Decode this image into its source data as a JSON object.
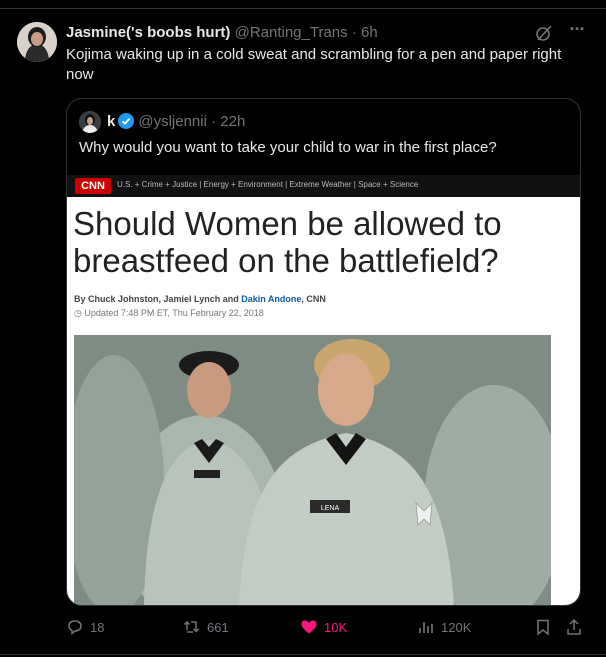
{
  "tweet": {
    "author_name": "Jasmine('s boobs hurt)",
    "author_handle": "@Ranting_Trans",
    "time": "· 6h",
    "text": "Kojima waking up in a cold sweat and scrambling for a pen and paper right now"
  },
  "quoted": {
    "author_name": "k",
    "author_handle": "@ysljennii",
    "time": "· 22h",
    "text": "Why would you want to take your child to war in the first place?",
    "article": {
      "logo": "CNN",
      "nav": "U.S. + Crime + Justice | Energy + Environment | Extreme Weather | Space + Science",
      "headline": "Should Women be allowed to breastfeed on the battlefield?",
      "byline_prefix": "By Chuck Johnston, Jamiel Lynch and ",
      "byline_link": "Dakin Andone",
      "byline_suffix": ", CNN",
      "updated": "Updated 7:48 PM ET, Thu February 22, 2018",
      "name_tag": "LENA"
    }
  },
  "actions": {
    "replies": "18",
    "reposts": "661",
    "likes": "10K",
    "views": "120K"
  },
  "colors": {
    "background": "#000000",
    "text": "#e7e9ea",
    "muted": "#71767b",
    "like": "#f91880",
    "verified": "#1d9bf0",
    "cnn_red": "#cc0000"
  },
  "icons": [
    "grok-icon",
    "more-icon",
    "verified-icon",
    "reply-icon",
    "repost-icon",
    "like-icon",
    "views-icon",
    "bookmark-icon",
    "share-icon"
  ]
}
